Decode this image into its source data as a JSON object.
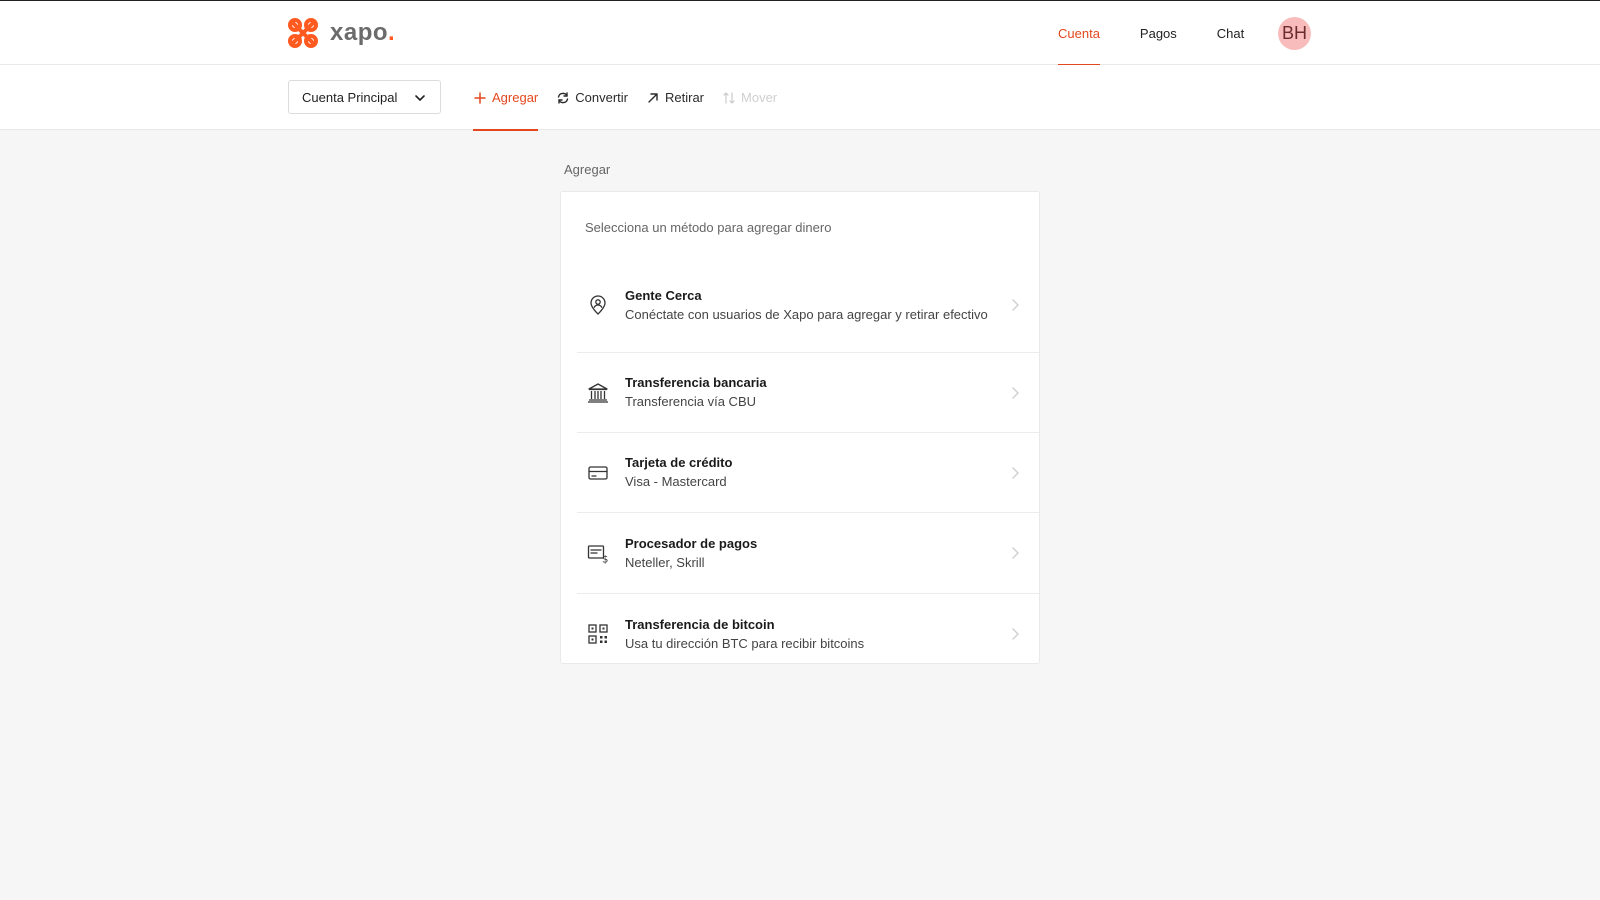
{
  "brand": {
    "name": "xapo",
    "dot": ".",
    "color": "#ff5a1f"
  },
  "topnav": {
    "items": [
      {
        "label": "Cuenta",
        "active": true
      },
      {
        "label": "Pagos",
        "active": false
      },
      {
        "label": "Chat",
        "active": false
      }
    ],
    "avatar_initials": "BH"
  },
  "subbar": {
    "account_label": "Cuenta Principal",
    "actions": [
      {
        "label": "Agregar",
        "icon": "plus-icon",
        "active": true
      },
      {
        "label": "Convertir",
        "icon": "refresh-icon",
        "active": false
      },
      {
        "label": "Retirar",
        "icon": "arrow-up-right-icon",
        "active": false
      },
      {
        "label": "Mover",
        "icon": "swap-vertical-icon",
        "disabled": true
      }
    ]
  },
  "main": {
    "section_title": "Agregar",
    "card_header": "Selecciona un método para agregar dinero",
    "methods": [
      {
        "title": "Gente Cerca",
        "subtitle": "Conéctate con usuarios de Xapo para agregar y retirar efectivo",
        "icon": "location-person-icon"
      },
      {
        "title": "Transferencia bancaria",
        "subtitle": "Transferencia vía CBU",
        "icon": "bank-icon"
      },
      {
        "title": "Tarjeta de crédito",
        "subtitle": "Visa - Mastercard",
        "icon": "credit-card-icon"
      },
      {
        "title": "Procesador de pagos",
        "subtitle": "Neteller, Skrill",
        "icon": "payment-processor-icon"
      },
      {
        "title": "Transferencia de bitcoin",
        "subtitle": "Usa tu dirección BTC para recibir bitcoins",
        "icon": "qr-code-icon"
      }
    ]
  },
  "colors": {
    "accent": "#e4471e",
    "avatar_bg": "#f9bcbc"
  }
}
